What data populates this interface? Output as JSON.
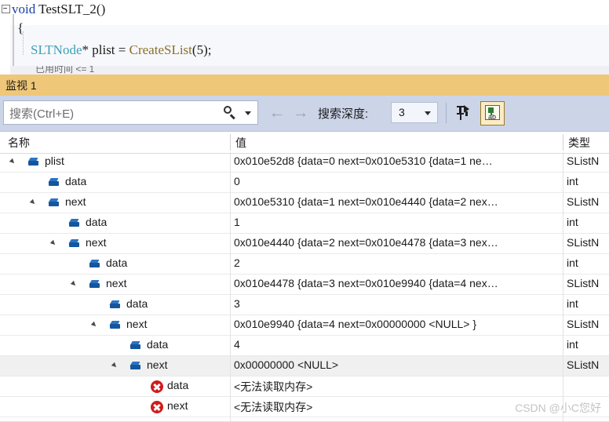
{
  "editor": {
    "lines": [
      {
        "fold": true,
        "segments": [
          {
            "t": "void ",
            "c": "kw"
          },
          {
            "t": "TestSLT_2",
            "c": "plain"
          },
          {
            "t": "()",
            "c": "plain"
          }
        ]
      },
      {
        "fold": false,
        "segments": [
          {
            "t": "{",
            "c": "plain"
          }
        ]
      },
      {
        "fold": false,
        "segments": [
          {
            "t": "    ",
            "c": "plain"
          },
          {
            "t": "SLTNode",
            "c": "type-c"
          },
          {
            "t": "* ",
            "c": "plain"
          },
          {
            "t": "plist",
            "c": "plain"
          },
          {
            "t": " = ",
            "c": "plain"
          },
          {
            "t": "CreateSList",
            "c": "fn"
          },
          {
            "t": "(",
            "c": "plain"
          },
          {
            "t": "5",
            "c": "num"
          },
          {
            "t": ");",
            "c": "plain"
          }
        ]
      },
      {
        "fold": false,
        "segments": [
          {
            "t": "}",
            "c": "plain"
          }
        ]
      }
    ],
    "tip": "已用时间 <= 1"
  },
  "watch": {
    "title": "监视 1",
    "search": {
      "placeholder": "搜索(Ctrl+E)",
      "magnifier_icon": "search-icon",
      "dropdown_icon": "chevron-down-icon"
    },
    "nav": {
      "back_icon": "←",
      "forward_icon": "→"
    },
    "depth": {
      "label": "搜索深度:",
      "value": "3",
      "dropdown_icon": "chevron-down-icon"
    },
    "buttons": [
      {
        "name": "pin-filter-button",
        "icon": "pin-filter-icon",
        "active": false
      },
      {
        "name": "hex-display-button",
        "icon": "hex-ab-icon",
        "active": true
      }
    ]
  },
  "grid": {
    "columns": [
      {
        "key": "name",
        "label": "名称"
      },
      {
        "key": "value",
        "label": "值"
      },
      {
        "key": "type",
        "label": "类型"
      }
    ],
    "rows": [
      {
        "depth": 0,
        "expander": "expanded",
        "icon": "field-icon",
        "name": "plist",
        "value": "0x010e52d8 {data=0 next=0x010e5310 {data=1 ne…",
        "type": "SListN",
        "selected": false
      },
      {
        "depth": 1,
        "expander": "none",
        "icon": "field-icon",
        "name": "data",
        "value": "0",
        "type": "int",
        "selected": false
      },
      {
        "depth": 1,
        "expander": "expanded",
        "icon": "field-icon",
        "name": "next",
        "value": "0x010e5310 {data=1 next=0x010e4440 {data=2 nex…",
        "type": "SListN",
        "selected": false
      },
      {
        "depth": 2,
        "expander": "none",
        "icon": "field-icon",
        "name": "data",
        "value": "1",
        "type": "int",
        "selected": false
      },
      {
        "depth": 2,
        "expander": "expanded",
        "icon": "field-icon",
        "name": "next",
        "value": "0x010e4440 {data=2 next=0x010e4478 {data=3 nex…",
        "type": "SListN",
        "selected": false
      },
      {
        "depth": 3,
        "expander": "none",
        "icon": "field-icon",
        "name": "data",
        "value": "2",
        "type": "int",
        "selected": false
      },
      {
        "depth": 3,
        "expander": "expanded",
        "icon": "field-icon",
        "name": "next",
        "value": "0x010e4478 {data=3 next=0x010e9940 {data=4 nex…",
        "type": "SListN",
        "selected": false
      },
      {
        "depth": 4,
        "expander": "none",
        "icon": "field-icon",
        "name": "data",
        "value": "3",
        "type": "int",
        "selected": false
      },
      {
        "depth": 4,
        "expander": "expanded",
        "icon": "field-icon",
        "name": "next",
        "value": "0x010e9940 {data=4 next=0x00000000 <NULL> }",
        "type": "SListN",
        "selected": false
      },
      {
        "depth": 5,
        "expander": "none",
        "icon": "field-icon",
        "name": "data",
        "value": "4",
        "type": "int",
        "selected": false
      },
      {
        "depth": 5,
        "expander": "expanded",
        "icon": "field-icon",
        "name": "next",
        "value": "0x00000000 <NULL>",
        "type": "SListN",
        "selected": true
      },
      {
        "depth": 6,
        "expander": "none",
        "icon": "error-icon",
        "name": "data",
        "value": "<无法读取内存>",
        "type": "",
        "selected": false
      },
      {
        "depth": 6,
        "expander": "none",
        "icon": "error-icon",
        "name": "next",
        "value": "<无法读取内存>",
        "type": "",
        "selected": false
      }
    ]
  },
  "watermark": "CSDN @小C您好"
}
